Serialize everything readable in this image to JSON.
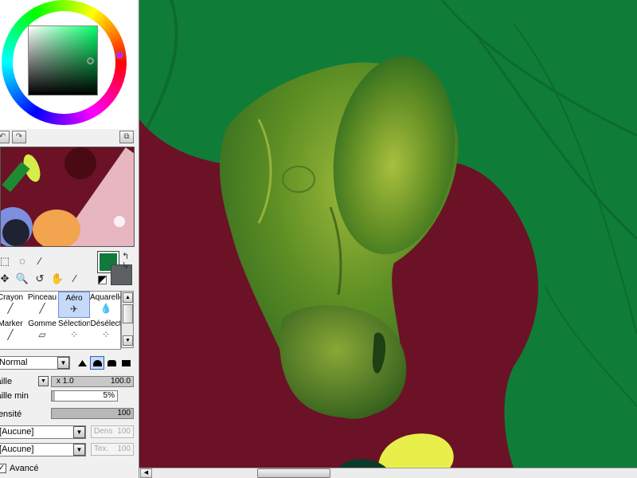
{
  "colors": {
    "foreground": "#0f7a3a",
    "background": "#5d6163",
    "canvas_green": "#0f7d38",
    "canvas_maroon": "#6b1226",
    "selection_blue": "#c7d9f8"
  },
  "icons": {
    "undo": "undo-icon",
    "redo": "redo-icon",
    "navigator": "navigator-icon",
    "swap": "swap-colors-icon",
    "reset": "reset-colors-icon"
  },
  "tools": [
    {
      "name": "rect-select-icon",
      "glyph": "⬚"
    },
    {
      "name": "lasso-icon",
      "glyph": "◌"
    },
    {
      "name": "magic-wand-icon",
      "glyph": "⁄"
    },
    {
      "name": "move-icon",
      "glyph": "✥"
    },
    {
      "name": "zoom-icon",
      "glyph": "🔍"
    },
    {
      "name": "rotate-icon",
      "glyph": "↺"
    },
    {
      "name": "hand-icon",
      "glyph": "✋"
    },
    {
      "name": "eyedropper-icon",
      "glyph": "⁄"
    }
  ],
  "brushes": [
    {
      "label": "Crayon",
      "glyph": "╱"
    },
    {
      "label": "Pinceau",
      "glyph": "╱"
    },
    {
      "label": "Aéro",
      "glyph": "✈"
    },
    {
      "label": "Aquarelle",
      "glyph": "💧"
    },
    {
      "label": "Marker",
      "glyph": "╱"
    },
    {
      "label": "Gomme",
      "glyph": "▱"
    },
    {
      "label": "Sélection",
      "glyph": "⁘"
    },
    {
      "label": "Désélect",
      "glyph": "⁘"
    }
  ],
  "selected_brush": "Aéro",
  "blend_mode": "Normal",
  "settings": {
    "size_label": "Taille",
    "size_multiplier": "x 1.0",
    "size_value": "100.0",
    "min_size_label": "Taille min",
    "min_size_value": "5%",
    "min_size_fraction": 0.05,
    "density_label": "Densité",
    "density_value": "100",
    "density_fraction": 1.0,
    "texture1": "[Aucune]",
    "texture2": "[Aucune]",
    "dens_label": "Dens",
    "dens_value": "100",
    "tex_label": "Tex.",
    "tex_value": "100",
    "advanced_label": "Avancé",
    "advanced_checked": true
  },
  "scrollbar": {
    "left_arrow": "◀"
  }
}
